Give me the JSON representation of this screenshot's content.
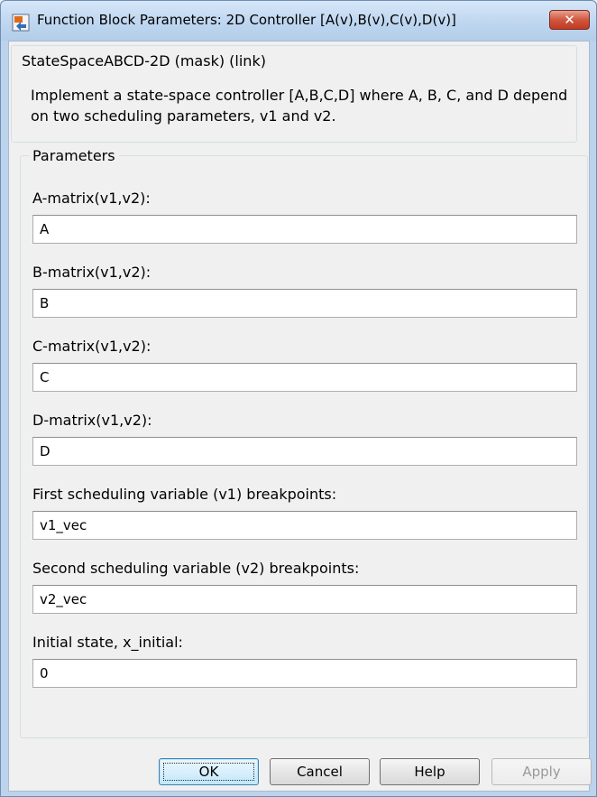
{
  "window": {
    "title": "Function Block Parameters: 2D Controller [A(v),B(v),C(v),D(v)]",
    "close_label": "✕",
    "icon": "simulink-block-icon"
  },
  "mask": {
    "title": "StateSpaceABCD-2D (mask) (link)",
    "description": "Implement a state-space controller [A,B,C,D] where A, B, C, and D depend on two scheduling parameters, v1 and v2."
  },
  "parameters": {
    "title": "Parameters",
    "fields": [
      {
        "label": "A-matrix(v1,v2):",
        "value": "A"
      },
      {
        "label": "B-matrix(v1,v2):",
        "value": "B"
      },
      {
        "label": "C-matrix(v1,v2):",
        "value": "C"
      },
      {
        "label": "D-matrix(v1,v2):",
        "value": "D"
      },
      {
        "label": "First scheduling variable (v1) breakpoints:",
        "value": "v1_vec"
      },
      {
        "label": "Second scheduling variable (v2) breakpoints:",
        "value": "v2_vec"
      },
      {
        "label": "Initial state, x_initial:",
        "value": "0"
      }
    ]
  },
  "buttons": {
    "ok": "OK",
    "cancel": "Cancel",
    "help": "Help",
    "apply": "Apply"
  }
}
